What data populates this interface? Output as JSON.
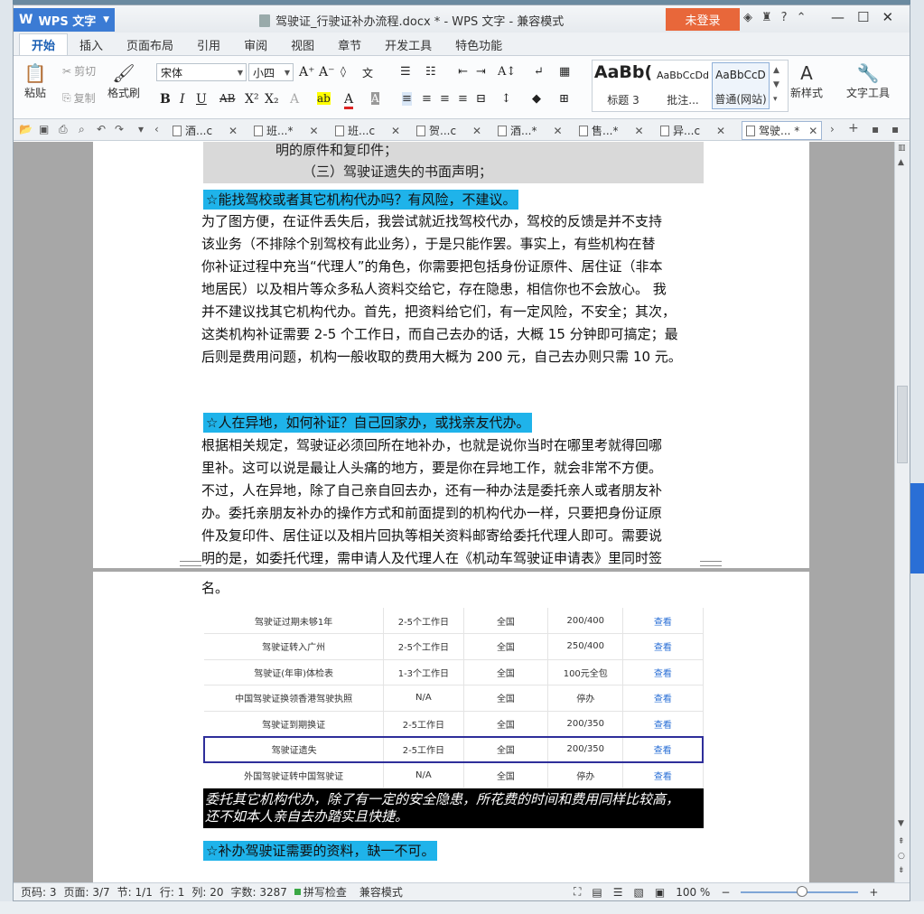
{
  "app": {
    "name": "WPS 文字",
    "window_title": "驾驶证_行驶证补办流程.docx * - WPS 文字 - 兼容模式",
    "login_label": "未登录"
  },
  "ribbon_tabs": [
    "开始",
    "插入",
    "页面布局",
    "引用",
    "审阅",
    "视图",
    "章节",
    "开发工具",
    "特色功能"
  ],
  "ribbon": {
    "paste": "粘贴",
    "cut": "剪切",
    "copy": "复制",
    "format_painter": "格式刷",
    "font_name": "宋体",
    "font_size": "小四",
    "styles": [
      {
        "sample": "AaBb(",
        "name": "标题 3"
      },
      {
        "sample": "AaBbCcDd",
        "name": "批注..."
      },
      {
        "sample": "AaBbCcD",
        "name": "普通(网站)"
      }
    ],
    "new_style": "新样式",
    "text_tools": "文字工具"
  },
  "doc_tabs": [
    "酒...c",
    "班...*",
    "班...c",
    "贺...c",
    "酒...*",
    "售...*",
    "异...c",
    "驾驶... *"
  ],
  "document": {
    "scan_lines": [
      "明的原件和复印件；",
      "（三）驾驶证遗失的书面声明；"
    ],
    "heading1": "☆能找驾校或者其它机构代办吗？有风险，不建议。",
    "para1": [
      "为了图方便，在证件丢失后，我尝试就近找驾校代办，驾校的反馈是并不支持",
      "该业务（不排除个别驾校有此业务），于是只能作罢。事实上，有些机构在替",
      "你补证过程中充当“代理人”的角色，你需要把包括身份证原件、居住证（非本",
      "地居民）以及相片等众多私人资料交给它，存在隐患，相信你也不会放心。 我",
      "并不建议找其它机构代办。首先，把资料给它们，有一定风险，不安全；其次，",
      "这类机构补证需要 2-5 个工作日，而自己去办的话，大概 15 分钟即可搞定；最",
      "后则是费用问题，机构一般收取的费用大概为 200 元，自己去办则只需 10 元。"
    ],
    "heading2": "☆人在异地，如何补证？自己回家办，或找亲友代办。",
    "para2": [
      "根据相关规定，驾驶证必须回所在地补办，也就是说你当时在哪里考就得回哪",
      "里补。这可以说是最让人头痛的地方，要是你在异地工作，就会非常不方便。",
      "不过，人在异地，除了自己亲自回去办，还有一种办法是委托亲人或者朋友补",
      "办。委托亲朋友补办的操作方式和前面提到的机构代办一样，只要把身份证原",
      "件及复印件、居住证以及相片回执等相关资料邮寄给委托代理人即可。需要说",
      "明的是，如委托代理，需申请人及代理人在《机动车驾驶证申请表》里同时签"
    ],
    "para2_end": "名。",
    "table_rows": [
      [
        "驾驶证过期未够1年",
        "2-5个工作日",
        "全国",
        "200/400",
        "查看"
      ],
      [
        "驾驶证转入广州",
        "2-5个工作日",
        "全国",
        "250/400",
        "查看"
      ],
      [
        "驾驶证(年审)体检表",
        "1-3个工作日",
        "全国",
        "100元全包",
        "查看"
      ],
      [
        "中国驾驶证换领香港驾驶执照",
        "N/A",
        "全国",
        "停办",
        "查看"
      ],
      [
        "驾驶证到期换证",
        "2-5工作日",
        "全国",
        "200/350",
        "查看"
      ],
      [
        "驾驶证遗失",
        "2-5工作日",
        "全国",
        "200/350",
        "查看"
      ],
      [
        "外国驾驶证转中国驾驶证",
        "N/A",
        "全国",
        "停办",
        "查看"
      ]
    ],
    "highlight_row": 5,
    "caption": [
      "委托其它机构代办，除了有一定的安全隐患，所花费的时间和费用同样比较高，",
      "还不如本人亲自去办踏实且快捷。"
    ],
    "heading3": "☆补办驾驶证需要的资料，缺一不可。"
  },
  "status": {
    "page_code": "页码: 3",
    "page": "页面: 3/7",
    "section": "节: 1/1",
    "row": "行: 1",
    "col": "列: 20",
    "words": "字数: 3287",
    "spell": "拼写检查",
    "compat": "兼容模式",
    "zoom": "100 %"
  },
  "colors": {
    "accent": "#3b7bd4",
    "login": "#e8673a",
    "highlight": "#1fb3ea",
    "table_frame": "#2e2e9a"
  }
}
